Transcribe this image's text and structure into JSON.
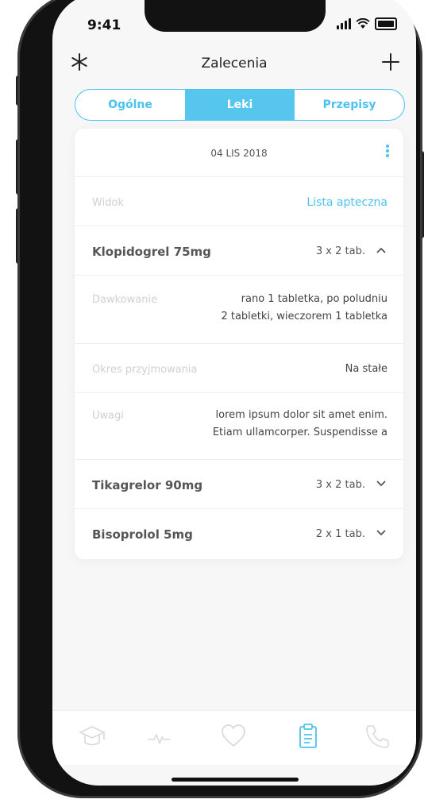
{
  "status_bar": {
    "time": "9:41"
  },
  "header": {
    "title": "Zalecenia",
    "left_icon": "asterisk-icon",
    "right_icon": "plus-icon"
  },
  "tabs": [
    {
      "label": "Ogólne",
      "active": false
    },
    {
      "label": "Leki",
      "active": true
    },
    {
      "label": "Przepisy",
      "active": false
    }
  ],
  "card": {
    "date": "04 LIS 2018",
    "view_label": "Widok",
    "view_link": "Lista apteczna",
    "drugs": [
      {
        "name": "Klopidogrel 75mg",
        "dose": "3 x 2 tab.",
        "expanded": true,
        "details": {
          "dosage_label": "Dawkowanie",
          "dosage_line1": "rano 1 tabletka, po poludniu",
          "dosage_line2": "2 tabletki, wieczorem 1 tabletka",
          "period_label": "Okres przyjmowania",
          "period_value": "Na stałe",
          "notes_label": "Uwagi",
          "notes_line1": "lorem ipsum dolor sit amet enim.",
          "notes_line2": "Etiam ullamcorper. Suspendisse a"
        }
      },
      {
        "name": "Tikagrelor 90mg",
        "dose": "3 x 2 tab.",
        "expanded": false
      },
      {
        "name": "Bisoprolol 5mg",
        "dose": "2 x 1 tab.",
        "expanded": false
      }
    ]
  },
  "tabbar": {
    "items": [
      "graduation-cap-icon",
      "heartbeat-icon",
      "heart-icon",
      "clipboard-icon",
      "phone-icon"
    ],
    "active_index": 3
  },
  "colors": {
    "accent": "#4cc2ee",
    "muted_label": "#cfcfd8",
    "text": "#555555"
  }
}
